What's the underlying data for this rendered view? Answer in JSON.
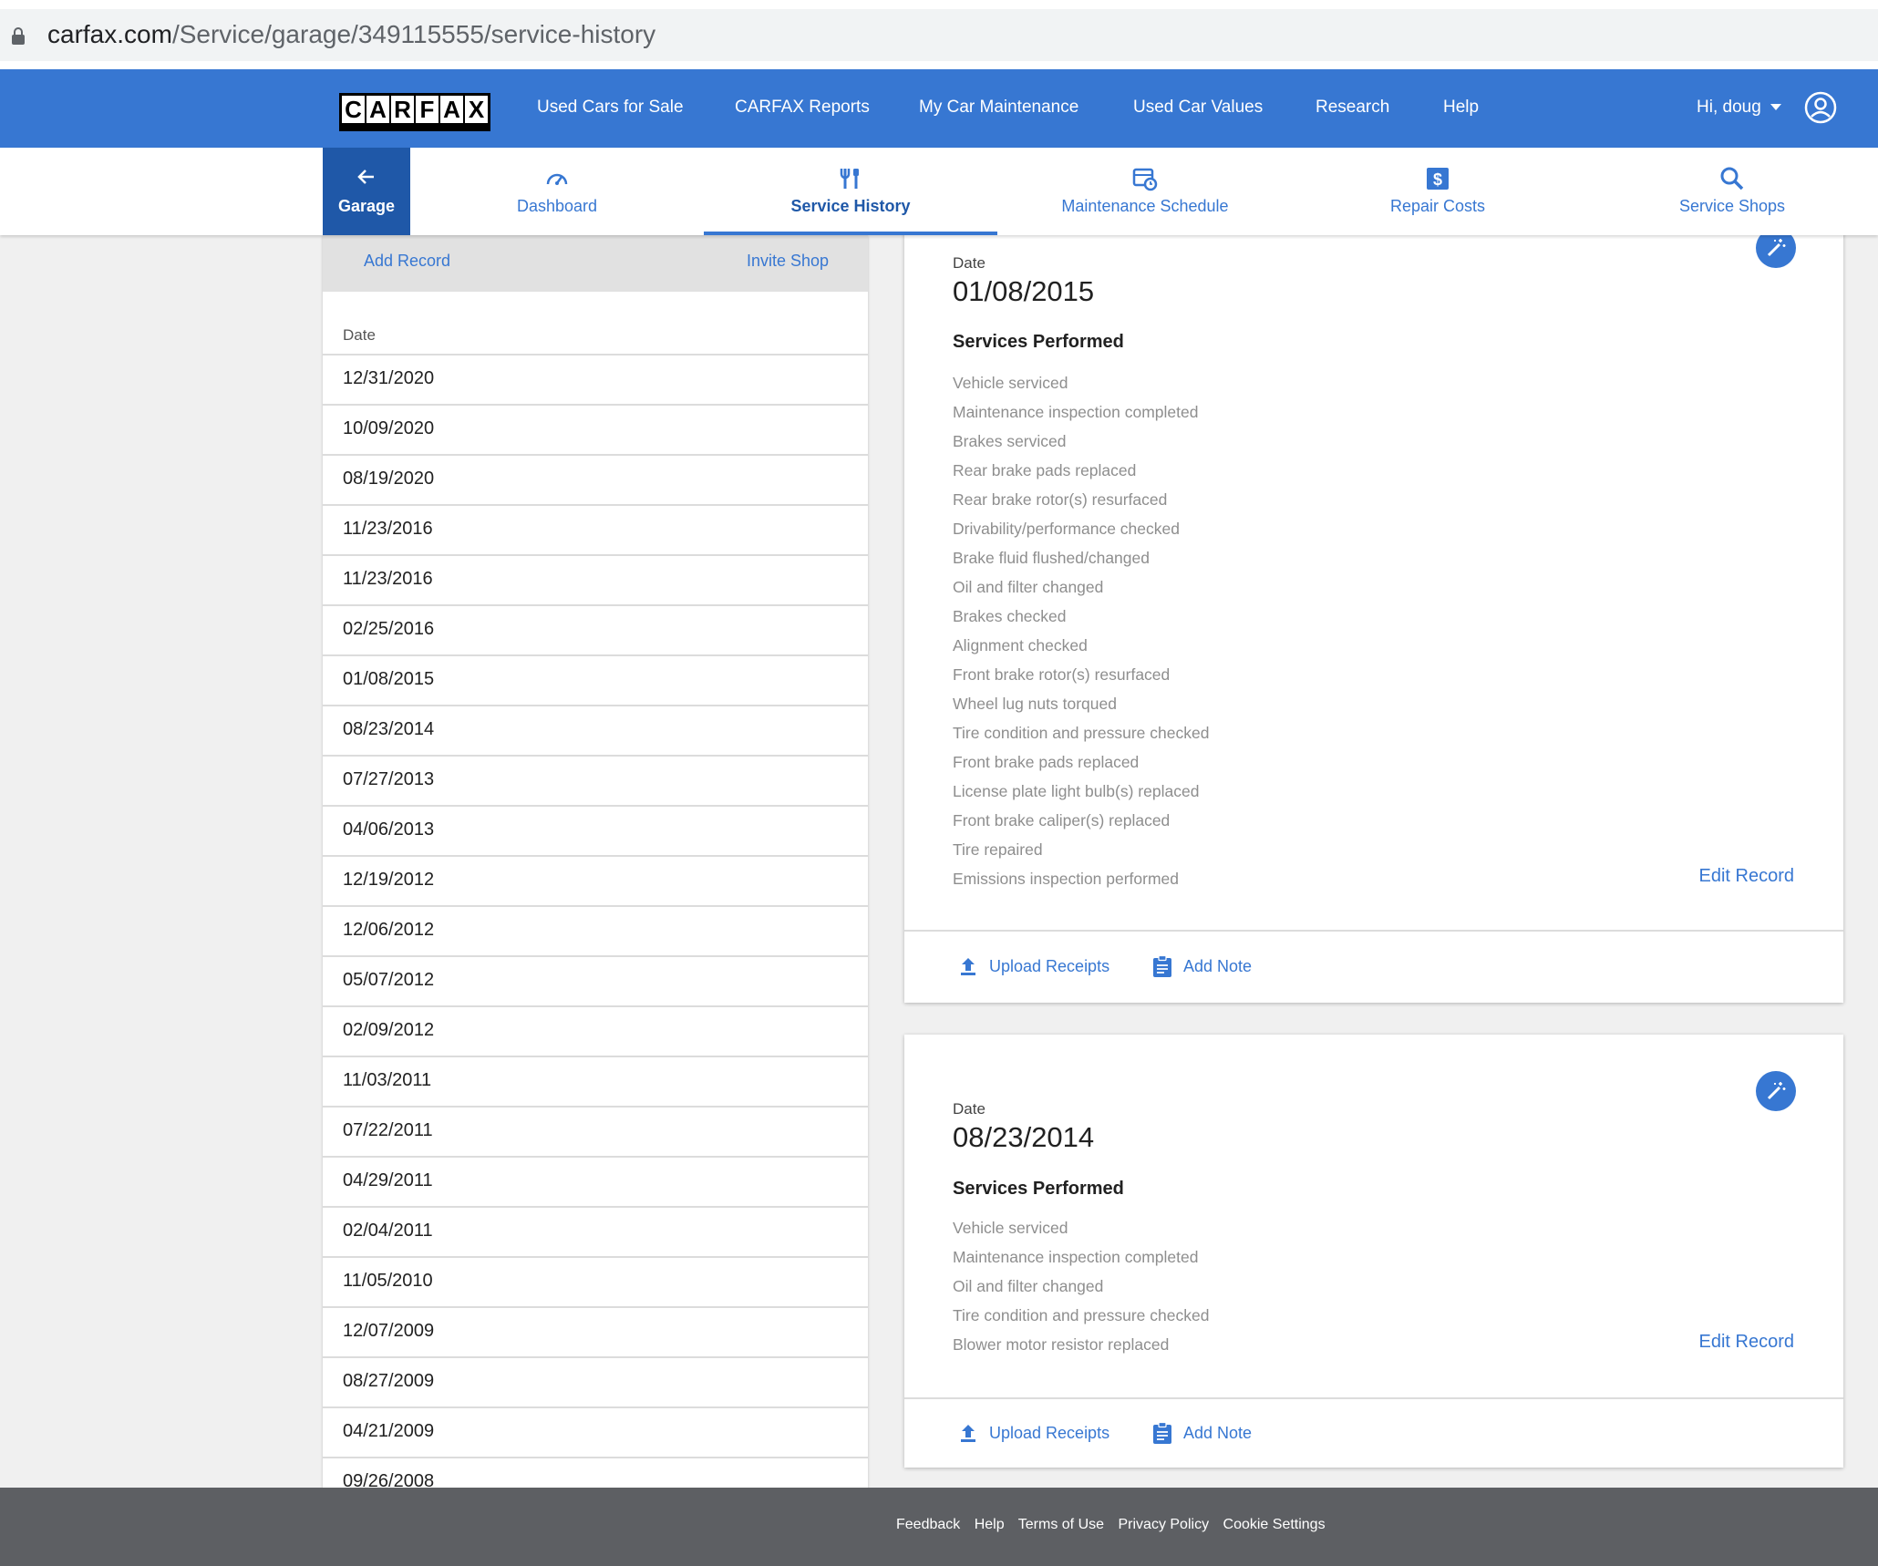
{
  "browser": {
    "url_domain": "carfax.com",
    "url_path": "/Service/garage/349115555/service-history"
  },
  "topnav": {
    "logo_letters": [
      "C",
      "A",
      "R",
      "F",
      "A",
      "X"
    ],
    "links": [
      "Used Cars for Sale",
      "CARFAX Reports",
      "My Car Maintenance",
      "Used Car Values",
      "Research",
      "Help"
    ],
    "user_greeting": "Hi, doug"
  },
  "subnav": {
    "back_label": "Garage",
    "tabs": [
      {
        "label": "Dashboard",
        "icon": "speedometer-icon"
      },
      {
        "label": "Service History",
        "icon": "tools-icon",
        "active": true
      },
      {
        "label": "Maintenance Schedule",
        "icon": "calendar-clock-icon"
      },
      {
        "label": "Repair Costs",
        "icon": "dollar-icon"
      },
      {
        "label": "Service Shops",
        "icon": "search-icon"
      }
    ]
  },
  "leftpanel": {
    "add_record": "Add Record",
    "invite_shop": "Invite Shop",
    "date_header": "Date",
    "dates": [
      "12/31/2020",
      "10/09/2020",
      "08/19/2020",
      "11/23/2016",
      "11/23/2016",
      "02/25/2016",
      "01/08/2015",
      "08/23/2014",
      "07/27/2013",
      "04/06/2013",
      "12/19/2012",
      "12/06/2012",
      "05/07/2012",
      "02/09/2012",
      "11/03/2011",
      "07/22/2011",
      "04/29/2011",
      "02/04/2011",
      "11/05/2010",
      "12/07/2009",
      "08/27/2009",
      "04/21/2009",
      "09/26/2008"
    ]
  },
  "records": [
    {
      "date_label": "Date",
      "date": "01/08/2015",
      "services_title": "Services Performed",
      "services": [
        "Vehicle serviced",
        "Maintenance inspection completed",
        "Brakes serviced",
        "Rear brake pads replaced",
        "Rear brake rotor(s) resurfaced",
        "Drivability/performance checked",
        "Brake fluid flushed/changed",
        "Oil and filter changed",
        "Brakes checked",
        "Alignment checked",
        "Front brake rotor(s) resurfaced",
        "Wheel lug nuts torqued",
        "Tire condition and pressure checked",
        "Front brake pads replaced",
        "License plate light bulb(s) replaced",
        "Front brake caliper(s) replaced",
        "Tire repaired",
        "Emissions inspection performed"
      ],
      "edit_label": "Edit Record",
      "upload_label": "Upload Receipts",
      "note_label": "Add Note"
    },
    {
      "date_label": "Date",
      "date": "08/23/2014",
      "services_title": "Services Performed",
      "services": [
        "Vehicle serviced",
        "Maintenance inspection completed",
        "Oil and filter changed",
        "Tire condition and pressure checked",
        "Blower motor resistor replaced"
      ],
      "edit_label": "Edit Record",
      "upload_label": "Upload Receipts",
      "note_label": "Add Note"
    }
  ],
  "footer": {
    "links": [
      "Feedback",
      "Help",
      "Terms of Use",
      "Privacy Policy",
      "Cookie Settings"
    ]
  },
  "colors": {
    "brand_blue": "#3777d2",
    "dark_blue": "#1f58a8",
    "footer_gray": "#5d5f63"
  }
}
